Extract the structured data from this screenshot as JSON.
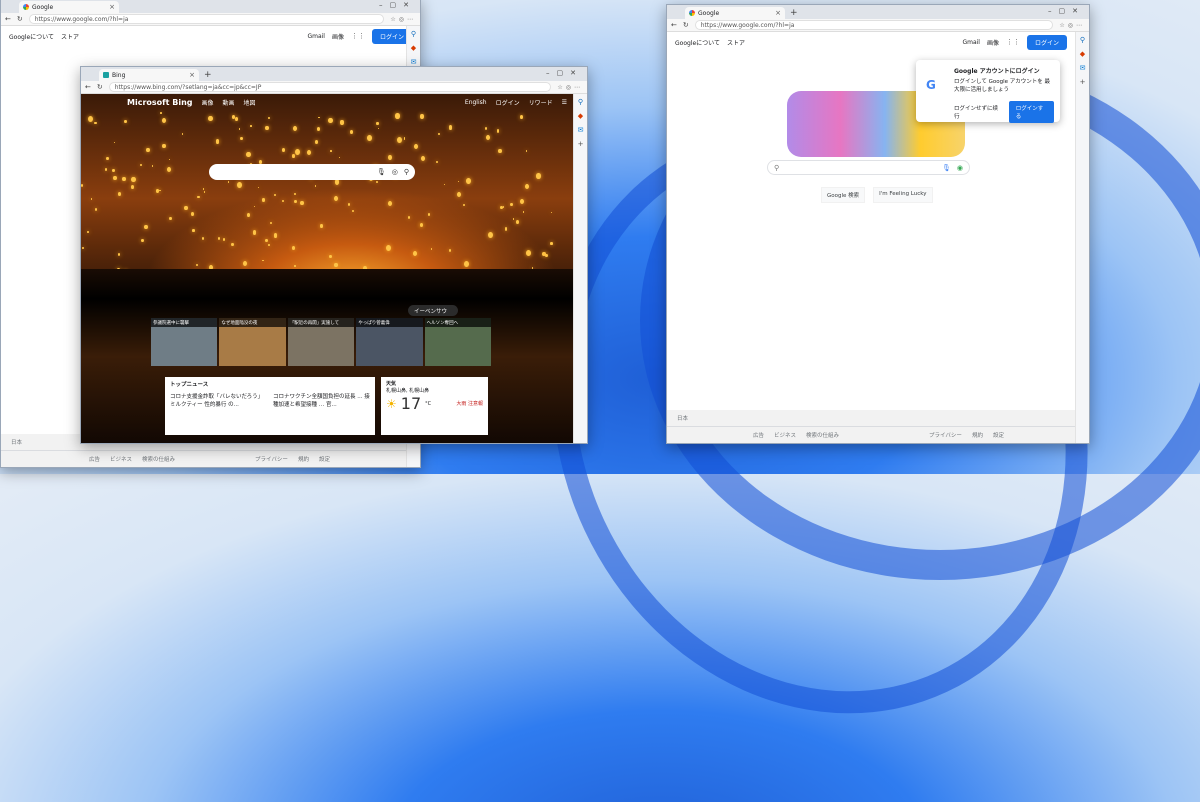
{
  "back_window": {
    "url": "https://www.google.com/?hl=ja",
    "tab_title": "Google",
    "nav_links": [
      "Googleについて",
      "ストア"
    ],
    "gmail": "Gmail",
    "images": "画像",
    "login": "ログイン",
    "footer_country": "日本",
    "footer_links": [
      "広告",
      "ビジネス",
      "検索の仕組み",
      "プライバシー",
      "規約",
      "設定"
    ]
  },
  "bing_window": {
    "tab_title": "Bing",
    "url": "https://www.bing.com/?setlang=ja&cc=jp&cc=JP",
    "logo": "Microsoft Bing",
    "nav": [
      "画像",
      "動画",
      "地図"
    ],
    "english": "English",
    "login": "ログイン",
    "rewards": "リワード",
    "event": "イーベンサウ",
    "news_captions": [
      "参議院選中に襲撃",
      "なぜ地面陥没の夜",
      "「駅近の再開」実施して",
      "やっぱり菅義偉",
      "ヘルソン奪回へ"
    ],
    "top_news_title": "トップニュース",
    "news_items": [
      "コロナ支援金詐取「バレないだろう」 ミルクティー 性的暴行 の...",
      "コロナワクチン全額国負担の延長 ... 接種加速と希望接種 … 官..."
    ],
    "weather_title": "天気",
    "weather_location": "札幌山鼻, 札幌山鼻",
    "temp": "17",
    "temp_unit": "°C",
    "alert": "大雨 注意報"
  },
  "right_window": {
    "tab_title": "Google",
    "url": "https://www.google.com/?hl=ja",
    "nav_links": [
      "Googleについて",
      "ストア"
    ],
    "gmail": "Gmail",
    "images": "画像",
    "login": "ログイン",
    "popup_title": "Google アカウントにログイン",
    "popup_body": "ログインして Google アカウントを 最大限に活用しましょう",
    "popup_decline": "ログインせずに续行",
    "popup_login": "ログインする",
    "search_btn": "Google 検索",
    "lucky_btn": "I'm Feeling Lucky",
    "footer_country": "日本",
    "footer_links": [
      "広告",
      "ビジネス",
      "検索の仕組み",
      "プライバシー",
      "規約",
      "設定"
    ]
  }
}
